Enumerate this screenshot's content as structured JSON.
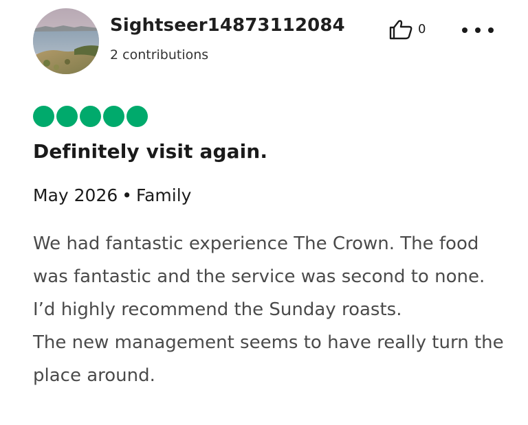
{
  "review": {
    "author": {
      "username": "Sightseer14873112084",
      "contributions": "2 contributions",
      "avatar": "landscape-photo"
    },
    "helpful": {
      "icon": "thumbs-up-icon",
      "count": "0"
    },
    "more_icon": "more-options-icon",
    "rating": {
      "value": 5,
      "max": 5,
      "color": "#00aa6c"
    },
    "title": "Definitely visit again.",
    "date": "May 2026",
    "separator": "•",
    "trip_type": "Family",
    "body": [
      "We had fantastic experience The Crown. The food was fantastic and the service was second to none. I’d highly recommend the Sunday roasts.",
      "The new management seems to have really turn the place around."
    ]
  }
}
